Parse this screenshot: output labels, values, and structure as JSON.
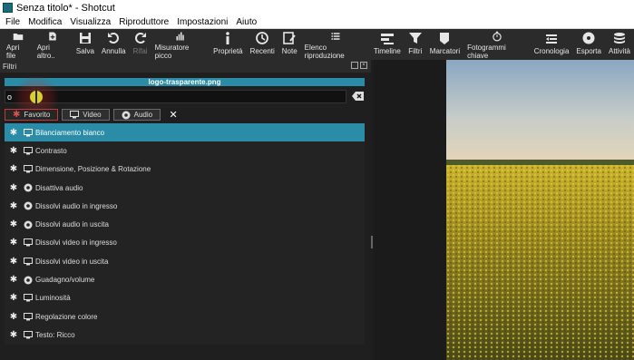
{
  "window": {
    "title": "Senza titolo* - Shotcut"
  },
  "menu": [
    "File",
    "Modifica",
    "Visualizza",
    "Riproduttore",
    "Impostazioni",
    "Aiuto"
  ],
  "toolbar": [
    {
      "label": "Apri file",
      "icon": "folder-icon"
    },
    {
      "label": "Apri altro..",
      "icon": "open-other-icon"
    },
    {
      "label": "Salva",
      "icon": "save-icon"
    },
    {
      "label": "Annulla",
      "icon": "undo-icon"
    },
    {
      "label": "Rifai",
      "icon": "redo-icon"
    },
    {
      "label": "Misuratore picco",
      "icon": "peak-meter-icon"
    },
    {
      "label": "Proprietà",
      "icon": "info-icon"
    },
    {
      "label": "Recenti",
      "icon": "clock-icon"
    },
    {
      "label": "Note",
      "icon": "note-icon"
    },
    {
      "label": "Elenco riproduzione",
      "icon": "playlist-icon"
    },
    {
      "label": "Timeline",
      "icon": "timeline-icon"
    },
    {
      "label": "Filtri",
      "icon": "filter-icon"
    },
    {
      "label": "Marcatori",
      "icon": "marker-icon"
    },
    {
      "label": "Fotogrammi chiave",
      "icon": "stopwatch-icon"
    },
    {
      "label": "Cronologia",
      "icon": "history-icon"
    },
    {
      "label": "Esporta",
      "icon": "export-icon"
    },
    {
      "label": "Attività",
      "icon": "jobs-icon"
    }
  ],
  "filters_panel": {
    "title": "Filtri",
    "clip_name": "logo-trasparente.png",
    "search_value": "o",
    "tabs": [
      {
        "label": "Favorito",
        "icon": "star-icon"
      },
      {
        "label": "Video",
        "icon": "monitor-icon"
      },
      {
        "label": "Audio",
        "icon": "speaker-icon"
      }
    ],
    "items": [
      {
        "label": "Bilanciamento bianco",
        "type": "video"
      },
      {
        "label": "Contrasto",
        "type": "video"
      },
      {
        "label": "Dimensione, Posizione & Rotazione",
        "type": "video"
      },
      {
        "label": "Disattiva audio",
        "type": "audio"
      },
      {
        "label": "Dissolvi audio in ingresso",
        "type": "audio"
      },
      {
        "label": "Dissolvi audio in uscita",
        "type": "audio"
      },
      {
        "label": "Dissolvi video in ingresso",
        "type": "video"
      },
      {
        "label": "Dissolvi video in uscita",
        "type": "video"
      },
      {
        "label": "Guadagno/volume",
        "type": "audio"
      },
      {
        "label": "Luminosità",
        "type": "video"
      },
      {
        "label": "Regolazione colore",
        "type": "video"
      },
      {
        "label": "Testo: Ricco",
        "type": "video"
      }
    ]
  },
  "colors": {
    "accent": "#2a8ca6",
    "active_tab_border": "#c03a3a"
  }
}
